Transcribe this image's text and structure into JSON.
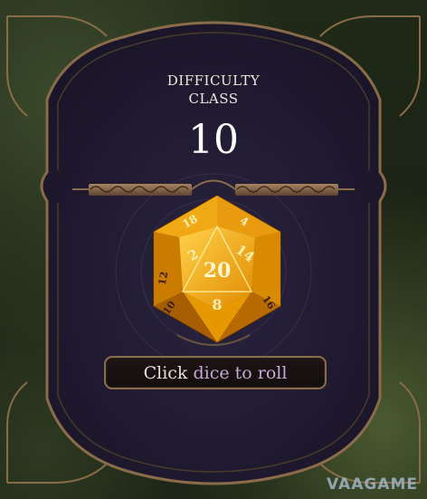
{
  "panel": {
    "title": "DIFFICULTY\nCLASS",
    "dc_value": "10"
  },
  "die": {
    "type": "d20",
    "face_numbers": [
      "20",
      "2",
      "14",
      "8",
      "18",
      "4",
      "12",
      "10",
      "16"
    ]
  },
  "roll_button": {
    "prefix": "Click",
    "highlight": "dice to roll"
  },
  "watermark": "VAAGAME",
  "colors": {
    "panel_bg": "#221c33",
    "frame": "#8a6c4a",
    "die_gold": "#f3a80c",
    "highlight_text": "#c8a9d6"
  }
}
